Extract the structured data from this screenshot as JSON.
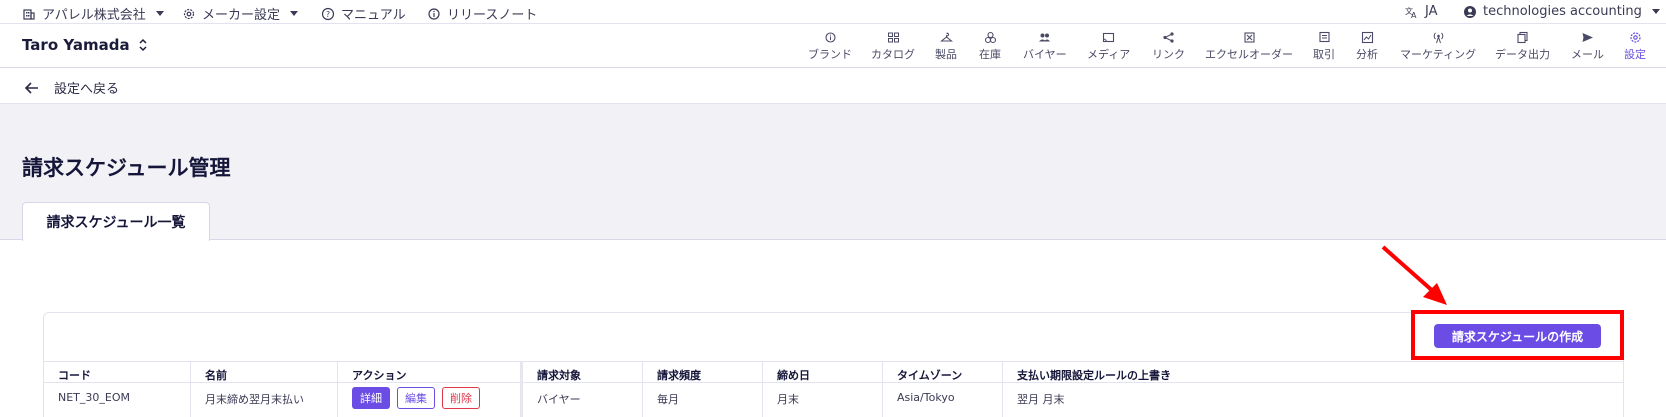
{
  "topbar": {
    "company": "アパレル株式会社",
    "maker_settings": "メーカー設定",
    "manual": "マニュアル",
    "release_notes": "リリースノート",
    "language": "JA",
    "account": "technologies accounting"
  },
  "navbar": {
    "user": "Taro Yamada",
    "items": [
      {
        "label": "ブランド",
        "icon": "info-icon"
      },
      {
        "label": "カタログ",
        "icon": "catalog-icon"
      },
      {
        "label": "製品",
        "icon": "hanger-icon"
      },
      {
        "label": "在庫",
        "icon": "boxes-icon"
      },
      {
        "label": "バイヤー",
        "icon": "people-icon"
      },
      {
        "label": "メディア",
        "icon": "cast-icon"
      },
      {
        "label": "リンク",
        "icon": "share-icon"
      },
      {
        "label": "エクセルオーダー",
        "icon": "excel-icon"
      },
      {
        "label": "取引",
        "icon": "receipt-icon"
      },
      {
        "label": "分析",
        "icon": "chart-icon"
      },
      {
        "label": "マーケティング",
        "icon": "antenna-icon"
      },
      {
        "label": "データ出力",
        "icon": "copy-icon"
      },
      {
        "label": "メール",
        "icon": "send-icon"
      },
      {
        "label": "設定",
        "icon": "gear-icon"
      }
    ],
    "active": "設定"
  },
  "back": {
    "label": "設定へ戻る"
  },
  "page": {
    "title": "請求スケジュール管理",
    "tab": "請求スケジュール一覧"
  },
  "create_button": "請求スケジュールの作成",
  "table": {
    "headers": [
      "コード",
      "名前",
      "アクション",
      "請求対象",
      "請求頻度",
      "締め日",
      "タイムゾーン",
      "支払い期限設定ルールの上書き"
    ],
    "rows": [
      {
        "code": "NET_30_EOM",
        "name": "月末締め翌月末払い",
        "actions": {
          "detail": "詳細",
          "edit": "編集",
          "delete": "削除"
        },
        "target": "バイヤー",
        "frequency": "毎月",
        "closing": "月末",
        "timezone": "Asia/Tokyo",
        "override": "翌月 月末"
      }
    ]
  },
  "colors": {
    "accent": "#6b4de6",
    "delete": "#e0384a",
    "annotation": "#ff0000"
  }
}
